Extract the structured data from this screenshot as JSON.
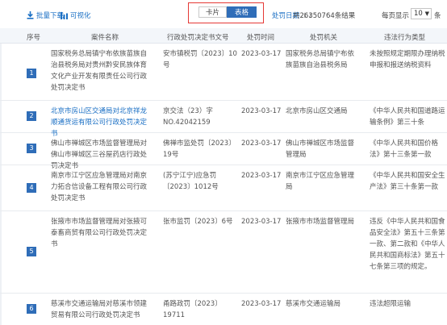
{
  "toolbar": {
    "batch_download": "批量下载",
    "visualize": "可视化",
    "view_card": "卡片",
    "view_table": "表格",
    "sort_label": "处罚日期",
    "sort_arrows": "⇂⇃",
    "total": "共26350764条结果",
    "per_page_label": "每页显示",
    "per_page_value": "10",
    "per_page_unit": "条"
  },
  "colors": {
    "accent": "#2f6db8",
    "link": "#1a6fc4",
    "highlight_border": "#e53935"
  },
  "table": {
    "headers": {
      "num": "序号",
      "title": "案件名称",
      "doc": "行政处罚决定书文号",
      "date": "处罚时间",
      "org": "处罚机关",
      "type": "违法行为类型"
    },
    "rows": [
      {
        "num": "1",
        "title": "国家税务总局镇宁布依族苗族自治县税务局对贵州黔安民族体育文化产业开发有限责任公司行政处罚决定书",
        "doc": "安市镇税罚〔2023〕10号",
        "date": "2023-03-17",
        "org": "国家税务总局镇宁布依族苗族自治县税务局",
        "type": "未按照规定期限办理纳税申报和报送纳税资料"
      },
      {
        "num": "2",
        "title": "北京市房山区交通局对北京祥龙顺通货运有限公司行政处罚决定书",
        "doc": "京交法（23）字NO.42042159",
        "date": "2023-03-17",
        "org": "北京市房山区交通局",
        "type": "《中华人民共和国道路运输条例》第三十条"
      },
      {
        "num": "3",
        "title": "佛山市禅城区市场监督管理局对佛山市禅城区三谷屋药店行政处罚决定书",
        "doc": "佛禅市监处罚〔2023〕19号",
        "date": "2023-03-17",
        "org": "佛山市禅城区市场监督管理局",
        "type": "《中华人民共和国价格法》第十三条第一款"
      },
      {
        "num": "4",
        "title": "南京市江宁区应急管理局对南京力拓合信设备工程有限公司行政处罚决定书",
        "doc": "(苏宁江宁)应急罚〔2023〕1012号",
        "date": "2023-03-17",
        "org": "南京市江宁区应急管理局",
        "type": "《中华人民共和国安全生产法》第三十条第一款"
      },
      {
        "num": "5",
        "title": "张掖市市场监督管理局对张掖可泰畜商贸有限公司行政处罚决定书",
        "doc": "张市监罚〔2023〕6号",
        "date": "2023-03-17",
        "org": "张掖市市场监督管理局",
        "type": "违反《中华人民共和国食品安全法》第五十三条第一款、第二款和《中华人民共和国商标法》第五十七条第三项的规定。"
      },
      {
        "num": "6",
        "title": "慈溪市交通运输局对慈溪市领建贸易有限公司行政处罚决定书",
        "doc": "甬路政罚〔2023〕19711",
        "date": "2023-03-17",
        "org": "慈溪市交通运输局",
        "type": "违法超限运输"
      }
    ]
  }
}
